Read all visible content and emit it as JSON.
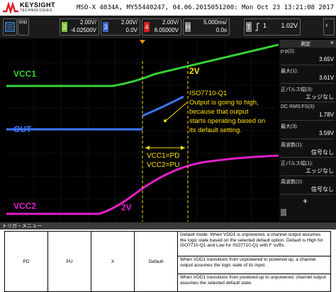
{
  "header": {
    "brand": "KEYSIGHT",
    "brand_sub": "TECHNOLOGIES",
    "scope_info": "MSO-X 4034A, MY55440247, 04.06.2015051200: Mon Oct 23 13:21:08 2017"
  },
  "toolbar": {
    "ch1_label": "50Ω",
    "ch2": {
      "num": "2",
      "scale": "2.00V/",
      "offset": "-4.02500V",
      "color": "#7ec832"
    },
    "ch3": {
      "num": "3",
      "scale": "2.00V/",
      "offset": "0.0V",
      "color": "#3a66d0"
    },
    "ch4": {
      "num": "4",
      "scale": "2.00V/",
      "offset": "6.05000V",
      "color": "#d02020"
    },
    "horizontal": {
      "label": "H",
      "scale": "5.000ms/",
      "offset": "0.0s"
    },
    "trigger": {
      "label": "T",
      "ch": "1",
      "value": "1.02V"
    }
  },
  "annotations": {
    "vcc1": "VCC1",
    "out": "OUT",
    "vcc2": "VCC2",
    "vcc1_level": "2V",
    "vcc2_level": "2V",
    "device_note_1": "ISO7710-Q1",
    "device_note_2": "Output is going to high,",
    "device_note_3": "because that output",
    "device_note_4": "starts operating based on",
    "device_note_5": "its default setting.",
    "state_1": "VCC1=PD",
    "state_2": "VCC2=PU"
  },
  "measurements": {
    "title": "測定",
    "items": [
      {
        "label": "p-p(2):",
        "value": "3.65V"
      },
      {
        "label": "最大(1):",
        "value": "3.61V"
      },
      {
        "label": "正パルス幅(3):",
        "value": "エッジなし"
      },
      {
        "label": "DC RMS:FS(3):",
        "value": "1.78V"
      },
      {
        "label": "最大(3):",
        "value": "3.59V"
      },
      {
        "label": "周波数(1):",
        "value": "信号なし"
      },
      {
        "label": "正パルス幅(1):",
        "value": "エッジなし"
      },
      {
        "label": "周波数(2):",
        "value": "信号なし"
      }
    ]
  },
  "bottom": {
    "trigger_menu": "トリガ・メニュー",
    "row": {
      "vcc1": "PD",
      "vcc2": "PU",
      "input": "X",
      "output": "Default"
    },
    "desc1": "Default mode: When VDD1 is unpowered, a channel output assumes the logic state based on the selected default option. Default is High for ISO7710-Q1 and Low for ISO7710-Q1 with F suffix.",
    "desc2": "When VDD1 transitions from unpowered to powered-up, a channel output assumes the logic state of its input.",
    "desc3": "When VDD1 transitions from powered-up to unpowered, channel output assumes the selected default state."
  },
  "colors": {
    "green": "#36d236",
    "blue": "#3c78ff",
    "pink": "#e020c8",
    "annot_yellow": "#ffe000"
  }
}
